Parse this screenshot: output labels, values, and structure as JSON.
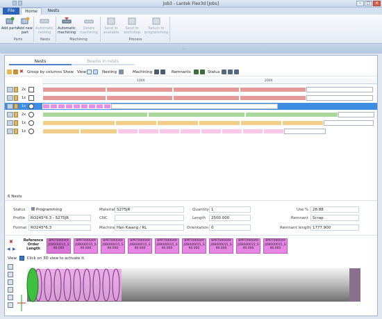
{
  "window": {
    "title": "Job3 - Lantek Flex3d [Jobs]"
  },
  "tabs": {
    "file": "File",
    "home": "Home",
    "nests": "Nests"
  },
  "ribbon": {
    "buttons": {
      "add_parts": "Add parts",
      "add_new_part": "Add new part",
      "automatic_nesting": "Automatic nesting",
      "automatic_machining": "Automatic machining",
      "delete_machining": "Delete machining",
      "send_to_available": "Send to available",
      "send_to_workshop": "Send to workshop",
      "return_to_programming": "Return to programming"
    },
    "groups": {
      "parts": "Parts",
      "nests": "Nests",
      "machining": "Machining",
      "process": "Process"
    }
  },
  "panel": {
    "tab_nests": "Nests",
    "tab_beams": "Beams in nests",
    "toolbar": {
      "group_by": "Group by columns",
      "show": "Show",
      "view": "View",
      "nesting": "Nesting",
      "machining": "Machining",
      "remnants": "Remnants",
      "status": "Status"
    },
    "ruler": [
      "1000",
      "2000"
    ],
    "rows": [
      {
        "mult": "2x",
        "shape": "square",
        "selected": false
      },
      {
        "mult": "1x",
        "shape": "square",
        "selected": false
      },
      {
        "mult": "1x",
        "shape": "circle",
        "selected": true
      },
      {
        "mult": "2x",
        "shape": "circle",
        "selected": false
      },
      {
        "mult": "1x",
        "shape": "circle",
        "selected": false
      },
      {
        "mult": "1x",
        "shape": "circle",
        "selected": false
      }
    ],
    "nest_count": "6 Nests"
  },
  "properties": {
    "status_label": "Status",
    "status_value": "Programming",
    "profile_label": "Profile",
    "profile_value": "RO245*6.3 - S275JR",
    "format_label": "Format",
    "format_value": "RO245*6.3",
    "material_label": "Material",
    "material_value": "S275JR",
    "cnc_label": "CNC",
    "cnc_value": "",
    "machine_label": "Machine",
    "machine_value": "Han Kwang / RL",
    "quantity_label": "Quantity",
    "quantity_value": "1",
    "length_label": "Length",
    "length_value": "2500.000",
    "orientation_label": "Orientation",
    "orientation_value": "0",
    "use_label": "Use %",
    "use_value": "28.88",
    "remnant_label": "Remnant",
    "remnant_value": "Scrap",
    "remnant_length_label": "Remnant length",
    "remnant_length_value": "1777.900"
  },
  "parts": {
    "header": "Reference Order Length",
    "tiles": [
      {
        "line1": "BPRT000049",
        "line2": "JOB000015_S",
        "line3": "90.000"
      },
      {
        "line1": "BPRT000049",
        "line2": "JOB000015_S",
        "line3": "90.000"
      },
      {
        "line1": "BPRT000049",
        "line2": "JOB000015_S",
        "line3": "90.000"
      },
      {
        "line1": "BPRT000049",
        "line2": "JOB000015_S",
        "line3": "90.000"
      },
      {
        "line1": "BPRT000049",
        "line2": "JOB000015_S",
        "line3": "90.000"
      },
      {
        "line1": "BPRT000049",
        "line2": "JOB000015_S",
        "line3": "90.000"
      },
      {
        "line1": "BPRT000049",
        "line2": "JOB000015_S",
        "line3": "90.000"
      },
      {
        "line1": "BPRT000049",
        "line2": "JOB000015_S",
        "line3": "90.000"
      },
      {
        "line1": "BPRT000049",
        "line2": "JOB000015_S",
        "line3": "90.000"
      }
    ]
  },
  "view3d": {
    "label": "View",
    "hint": "Click on 3D view to activate it."
  },
  "colors": {
    "red": "#e59a9a",
    "pink": "#e98fe8",
    "green": "#a9d99a",
    "orange": "#f1cf8a",
    "lightpink": "#f6c9e8",
    "select": "#3d8de3"
  }
}
